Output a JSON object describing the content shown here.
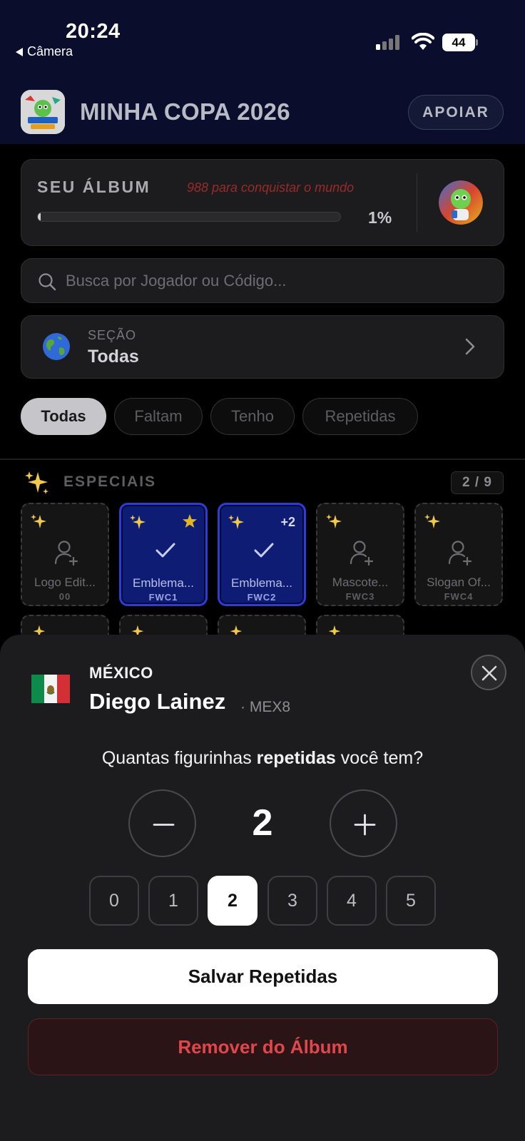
{
  "status_bar": {
    "time": "20:24",
    "back_label": "Câmera",
    "battery": "44"
  },
  "header": {
    "app_title": "MINHA COPA 2026",
    "support_label": "APOIAR"
  },
  "album": {
    "label": "SEU ÁLBUM",
    "goal_text": "988 para conquistar o mundo",
    "progress_percent_text": "1%",
    "progress_fraction": 0.01
  },
  "search": {
    "placeholder": "Busca por Jogador ou Código..."
  },
  "section": {
    "label": "SEÇÃO",
    "value": "Todas"
  },
  "filters": [
    {
      "label": "Todas",
      "active": true
    },
    {
      "label": "Faltam",
      "active": false
    },
    {
      "label": "Tenho",
      "active": false
    },
    {
      "label": "Repetidas",
      "active": false
    }
  ],
  "especiais": {
    "label": "ESPECIAIS",
    "count": "2 / 9",
    "stickers": [
      {
        "name": "Logo Edit...",
        "code": "00",
        "owned": false
      },
      {
        "name": "Emblema...",
        "code": "FWC1",
        "owned": true,
        "badge": "star"
      },
      {
        "name": "Emblema...",
        "code": "FWC2",
        "owned": true,
        "badge": "+2"
      },
      {
        "name": "Mascote...",
        "code": "FWC3",
        "owned": false
      },
      {
        "name": "Slogan Of...",
        "code": "FWC4",
        "owned": false
      }
    ]
  },
  "sheet": {
    "team": "MÉXICO",
    "player": "Diego Lainez",
    "code": "· MEX8",
    "question_pre": "Quantas figurinhas",
    "question_bold": "repetidas",
    "question_post": "você tem?",
    "count": "2",
    "quick_values": [
      "0",
      "1",
      "2",
      "3",
      "4",
      "5"
    ],
    "selected_quick": "2",
    "save_label": "Salvar Repetidas",
    "remove_label": "Remover do Álbum"
  },
  "colors": {
    "header_bg": "#0a0e2c",
    "owned_sticker": "#0f1c73",
    "danger": "#e0474c",
    "star": "#e6b422"
  }
}
